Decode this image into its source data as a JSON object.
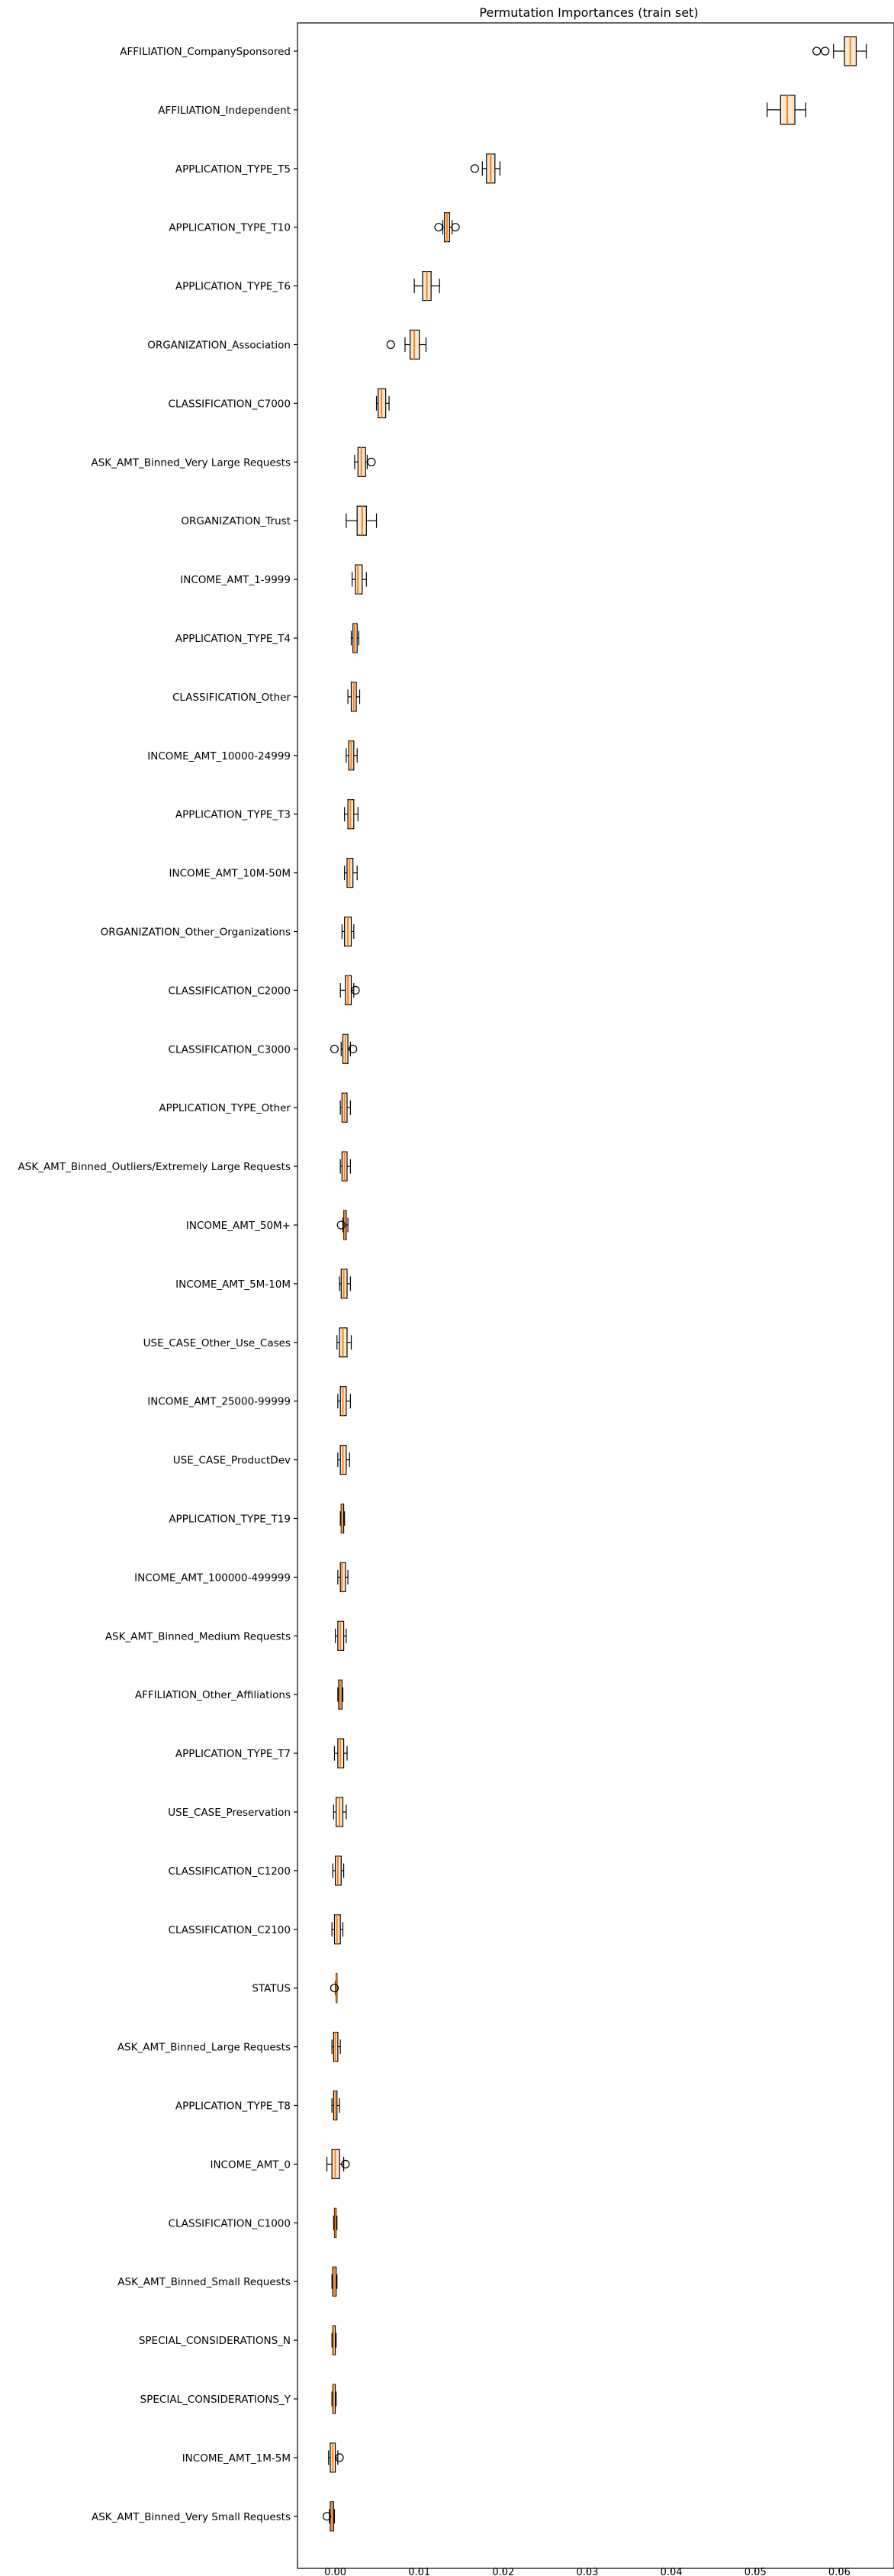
{
  "chart_data": {
    "type": "boxplot",
    "orientation": "horizontal",
    "title": "Permutation Importances (train set)",
    "xlabel": "",
    "ylabel": "",
    "xlim": [
      -0.0045,
      0.0665
    ],
    "x_ticks": [
      0.0,
      0.01,
      0.02,
      0.03,
      0.04,
      0.05,
      0.06
    ],
    "x_tick_labels": [
      "0.00",
      "0.01",
      "0.02",
      "0.03",
      "0.04",
      "0.05",
      "0.06"
    ],
    "grid": false,
    "colors": {
      "box_edge": "#000000",
      "box_fill": "#fde9d2",
      "median": "#ff7f0e"
    },
    "features": [
      {
        "name": "AFFILIATION_CompanySponsored",
        "whisker_low": 0.0593,
        "q1": 0.0606,
        "median": 0.0613,
        "q3": 0.062,
        "whisker_high": 0.0632,
        "fliers": [
          0.0573,
          0.0583
        ]
      },
      {
        "name": "AFFILIATION_Independent",
        "whisker_low": 0.0514,
        "q1": 0.053,
        "median": 0.0538,
        "q3": 0.0547,
        "whisker_high": 0.056,
        "fliers": []
      },
      {
        "name": "APPLICATION_TYPE_T5",
        "whisker_low": 0.0175,
        "q1": 0.018,
        "median": 0.0185,
        "q3": 0.019,
        "whisker_high": 0.0196,
        "fliers": [
          0.0166
        ]
      },
      {
        "name": "APPLICATION_TYPE_T10",
        "whisker_low": 0.0128,
        "q1": 0.013,
        "median": 0.0133,
        "q3": 0.0136,
        "whisker_high": 0.0139,
        "fliers": [
          0.0123,
          0.0143
        ]
      },
      {
        "name": "APPLICATION_TYPE_T6",
        "whisker_low": 0.0094,
        "q1": 0.0104,
        "median": 0.0109,
        "q3": 0.0114,
        "whisker_high": 0.0124,
        "fliers": []
      },
      {
        "name": "ORGANIZATION_Association",
        "whisker_low": 0.0083,
        "q1": 0.0089,
        "median": 0.0094,
        "q3": 0.01,
        "whisker_high": 0.0108,
        "fliers": [
          0.0066
        ]
      },
      {
        "name": "CLASSIFICATION_C7000",
        "whisker_low": 0.0049,
        "q1": 0.0051,
        "median": 0.0055,
        "q3": 0.006,
        "whisker_high": 0.0064,
        "fliers": []
      },
      {
        "name": "ASK_AMT_Binned_Very Large Requests",
        "whisker_low": 0.0023,
        "q1": 0.0027,
        "median": 0.0031,
        "q3": 0.0036,
        "whisker_high": 0.0038,
        "fliers": [
          0.0043
        ]
      },
      {
        "name": "ORGANIZATION_Trust",
        "whisker_low": 0.0013,
        "q1": 0.0026,
        "median": 0.0032,
        "q3": 0.0037,
        "whisker_high": 0.0049,
        "fliers": []
      },
      {
        "name": "INCOME_AMT_1-9999",
        "whisker_low": 0.002,
        "q1": 0.0024,
        "median": 0.0027,
        "q3": 0.0032,
        "whisker_high": 0.0037,
        "fliers": []
      },
      {
        "name": "APPLICATION_TYPE_T4",
        "whisker_low": 0.0019,
        "q1": 0.0021,
        "median": 0.0023,
        "q3": 0.0026,
        "whisker_high": 0.0028,
        "fliers": []
      },
      {
        "name": "CLASSIFICATION_Other",
        "whisker_low": 0.0015,
        "q1": 0.0019,
        "median": 0.0022,
        "q3": 0.0025,
        "whisker_high": 0.0029,
        "fliers": []
      },
      {
        "name": "INCOME_AMT_10000-24999",
        "whisker_low": 0.0013,
        "q1": 0.0016,
        "median": 0.0019,
        "q3": 0.0022,
        "whisker_high": 0.0026,
        "fliers": []
      },
      {
        "name": "APPLICATION_TYPE_T3",
        "whisker_low": 0.0011,
        "q1": 0.0015,
        "median": 0.0018,
        "q3": 0.0022,
        "whisker_high": 0.0027,
        "fliers": []
      },
      {
        "name": "INCOME_AMT_10M-50M",
        "whisker_low": 0.0011,
        "q1": 0.0014,
        "median": 0.0017,
        "q3": 0.0021,
        "whisker_high": 0.0026,
        "fliers": []
      },
      {
        "name": "ORGANIZATION_Other_Organizations",
        "whisker_low": 0.0008,
        "q1": 0.0011,
        "median": 0.0015,
        "q3": 0.0019,
        "whisker_high": 0.0022,
        "fliers": []
      },
      {
        "name": "CLASSIFICATION_C2000",
        "whisker_low": 0.0006,
        "q1": 0.0012,
        "median": 0.0015,
        "q3": 0.0019,
        "whisker_high": 0.0022,
        "fliers": [
          0.0024
        ]
      },
      {
        "name": "CLASSIFICATION_C3000",
        "whisker_low": 0.0007,
        "q1": 0.0009,
        "median": 0.0012,
        "q3": 0.0015,
        "whisker_high": 0.0018,
        "fliers": [
          -0.0001,
          0.0021
        ]
      },
      {
        "name": "APPLICATION_TYPE_Other",
        "whisker_low": 0.0006,
        "q1": 0.0008,
        "median": 0.0011,
        "q3": 0.0014,
        "whisker_high": 0.0018,
        "fliers": []
      },
      {
        "name": "ASK_AMT_Binned_Outliers/Extremely Large Requests",
        "whisker_low": 0.0006,
        "q1": 0.0008,
        "median": 0.0011,
        "q3": 0.0014,
        "whisker_high": 0.0018,
        "fliers": []
      },
      {
        "name": "INCOME_AMT_50M+",
        "whisker_low": 0.0009,
        "q1": 0.001,
        "median": 0.0011,
        "q3": 0.0013,
        "whisker_high": 0.0015,
        "fliers": [
          0.0007
        ]
      },
      {
        "name": "INCOME_AMT_5M-10M",
        "whisker_low": 0.0005,
        "q1": 0.0007,
        "median": 0.001,
        "q3": 0.0014,
        "whisker_high": 0.0018,
        "fliers": []
      },
      {
        "name": "USE_CASE_Other_Use_Cases",
        "whisker_low": 0.0002,
        "q1": 0.0005,
        "median": 0.0009,
        "q3": 0.0014,
        "whisker_high": 0.0019,
        "fliers": []
      },
      {
        "name": "INCOME_AMT_25000-99999",
        "whisker_low": 0.0003,
        "q1": 0.0006,
        "median": 0.0009,
        "q3": 0.0013,
        "whisker_high": 0.0018,
        "fliers": []
      },
      {
        "name": "USE_CASE_ProductDev",
        "whisker_low": 0.0003,
        "q1": 0.0006,
        "median": 0.0009,
        "q3": 0.0013,
        "whisker_high": 0.0017,
        "fliers": []
      },
      {
        "name": "APPLICATION_TYPE_T19",
        "whisker_low": 0.0006,
        "q1": 0.0007,
        "median": 0.0008,
        "q3": 0.001,
        "whisker_high": 0.0011,
        "fliers": []
      },
      {
        "name": "INCOME_AMT_100000-499999",
        "whisker_low": 0.0003,
        "q1": 0.0006,
        "median": 0.0008,
        "q3": 0.0012,
        "whisker_high": 0.0015,
        "fliers": []
      },
      {
        "name": "ASK_AMT_Binned_Medium Requests",
        "whisker_low": 0.0,
        "q1": 0.0003,
        "median": 0.0006,
        "q3": 0.001,
        "whisker_high": 0.0013,
        "fliers": []
      },
      {
        "name": "AFFILIATION_Other_Affiliations",
        "whisker_low": 0.0003,
        "q1": 0.0004,
        "median": 0.0006,
        "q3": 0.0008,
        "whisker_high": 0.0009,
        "fliers": []
      },
      {
        "name": "APPLICATION_TYPE_T7",
        "whisker_low": -0.0001,
        "q1": 0.0003,
        "median": 0.0006,
        "q3": 0.001,
        "whisker_high": 0.0014,
        "fliers": []
      },
      {
        "name": "USE_CASE_Preservation",
        "whisker_low": -0.0002,
        "q1": 0.0001,
        "median": 0.0005,
        "q3": 0.0009,
        "whisker_high": 0.0013,
        "fliers": []
      },
      {
        "name": "CLASSIFICATION_C1200",
        "whisker_low": -0.0003,
        "q1": 0.0,
        "median": 0.0003,
        "q3": 0.0007,
        "whisker_high": 0.001,
        "fliers": []
      },
      {
        "name": "CLASSIFICATION_C2100",
        "whisker_low": -0.0004,
        "q1": -0.0001,
        "median": 0.0002,
        "q3": 0.0006,
        "whisker_high": 0.0009,
        "fliers": []
      },
      {
        "name": "STATUS",
        "whisker_low": 0.0,
        "q1": 0.0001,
        "median": 0.0001,
        "q3": 0.0002,
        "whisker_high": 0.0002,
        "fliers": [
          -0.0001
        ]
      },
      {
        "name": "ASK_AMT_Binned_Large Requests",
        "whisker_low": -0.0004,
        "q1": -0.0002,
        "median": 0.0,
        "q3": 0.0003,
        "whisker_high": 0.0006,
        "fliers": []
      },
      {
        "name": "APPLICATION_TYPE_T8",
        "whisker_low": -0.0004,
        "q1": -0.0002,
        "median": 0.0,
        "q3": 0.0002,
        "whisker_high": 0.0005,
        "fliers": []
      },
      {
        "name": "INCOME_AMT_0",
        "whisker_low": -0.001,
        "q1": -0.0004,
        "median": 0.0,
        "q3": 0.0005,
        "whisker_high": 0.001,
        "fliers": [
          0.0012
        ]
      },
      {
        "name": "CLASSIFICATION_C1000",
        "whisker_low": -0.0002,
        "q1": -0.0001,
        "median": 0.0,
        "q3": 0.0001,
        "whisker_high": 0.0002,
        "fliers": []
      },
      {
        "name": "ASK_AMT_Binned_Small Requests",
        "whisker_low": -0.0004,
        "q1": -0.0003,
        "median": -0.0001,
        "q3": 0.0001,
        "whisker_high": 0.0002,
        "fliers": []
      },
      {
        "name": "SPECIAL_CONSIDERATIONS_N",
        "whisker_low": -0.0004,
        "q1": -0.0003,
        "median": -0.0002,
        "q3": 0.0,
        "whisker_high": 0.0001,
        "fliers": []
      },
      {
        "name": "SPECIAL_CONSIDERATIONS_Y",
        "whisker_low": -0.0004,
        "q1": -0.0003,
        "median": -0.0002,
        "q3": 0.0,
        "whisker_high": 0.0001,
        "fliers": []
      },
      {
        "name": "INCOME_AMT_1M-5M",
        "whisker_low": -0.0008,
        "q1": -0.0006,
        "median": -0.0003,
        "q3": 0.0,
        "whisker_high": 0.0003,
        "fliers": [
          0.0005
        ]
      },
      {
        "name": "ASK_AMT_Binned_Very Small Requests",
        "whisker_low": -0.0007,
        "q1": -0.0006,
        "median": -0.0004,
        "q3": -0.0002,
        "whisker_high": -0.0001,
        "fliers": [
          -0.001
        ]
      }
    ]
  }
}
